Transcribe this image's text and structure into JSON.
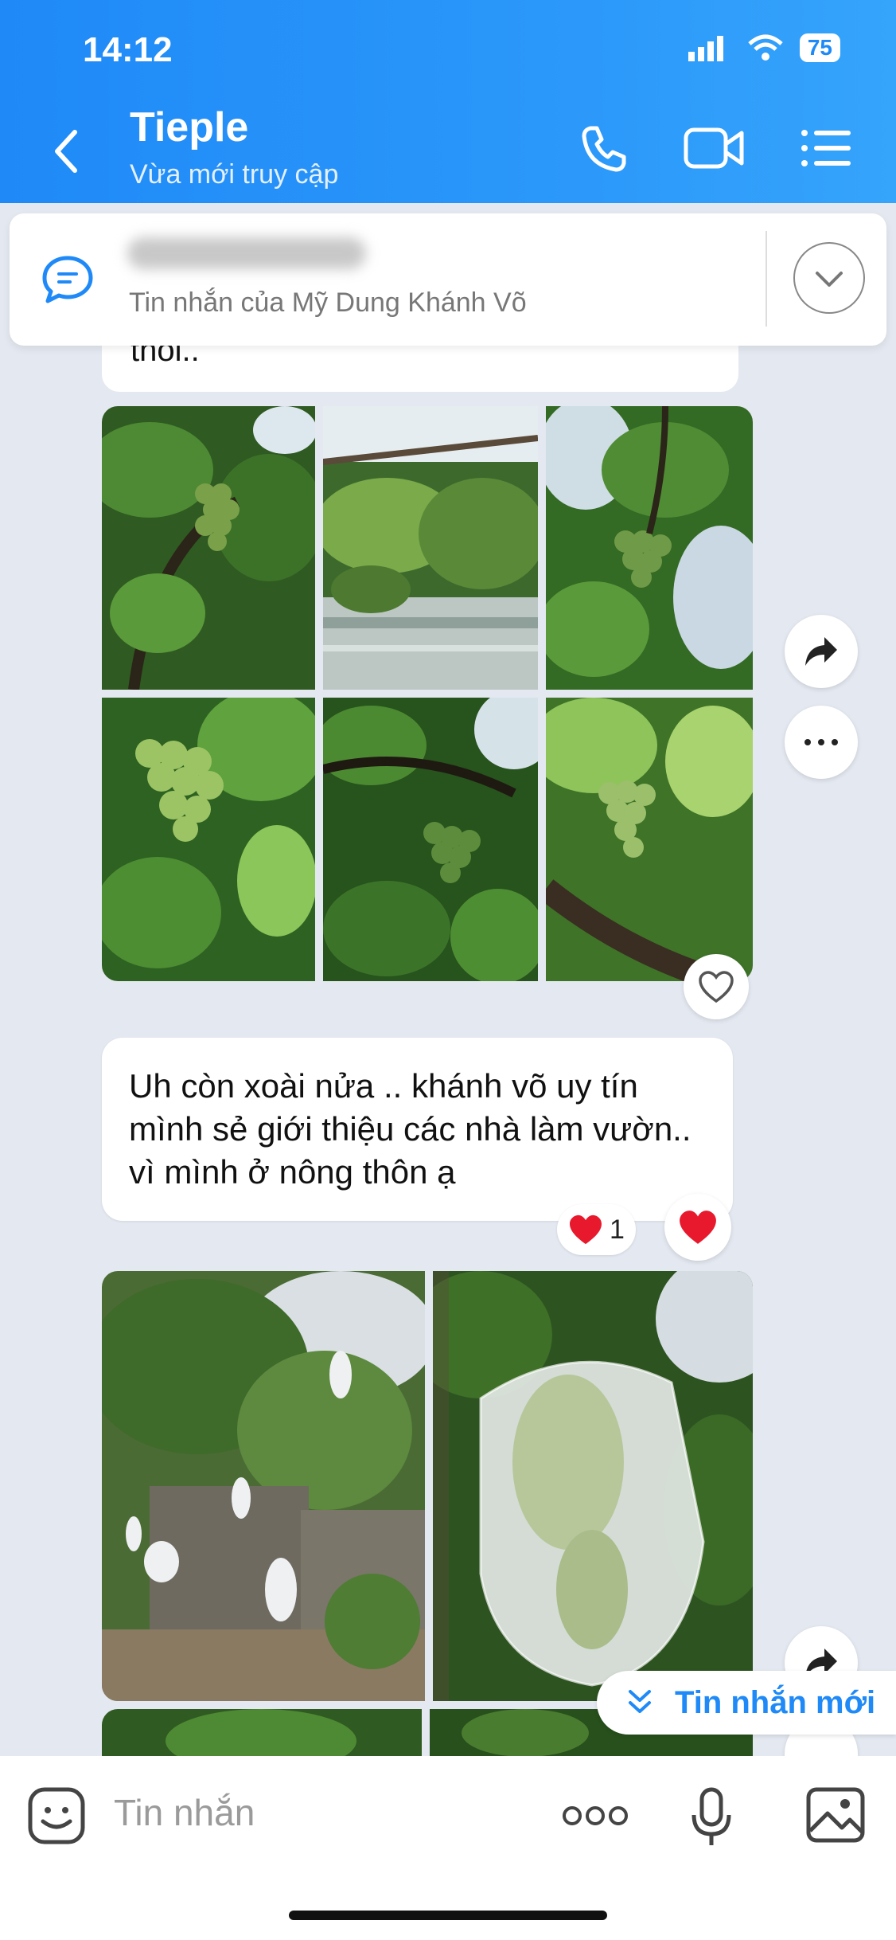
{
  "status_bar": {
    "time": "14:12",
    "battery": "75"
  },
  "header": {
    "title": "Tieple",
    "subtitle": "Vừa mới truy cập"
  },
  "pinned": {
    "text": "Tin nhắn của Mỹ Dung Khánh Võ"
  },
  "messages": {
    "partial_text": "thôi..",
    "text_message": "Uh còn xoài nửa .. khánh võ uy tín mình sẻ giới thiệu các nhà làm vườn.. vì mình ở nông thôn ạ",
    "reaction_count": "1"
  },
  "new_messages_label": "Tin nhắn mới",
  "composer": {
    "placeholder": "Tin nhắn"
  },
  "colors": {
    "header_blue": "#1f8af7",
    "accent": "#1f8af7",
    "heart": "#e8192c"
  }
}
